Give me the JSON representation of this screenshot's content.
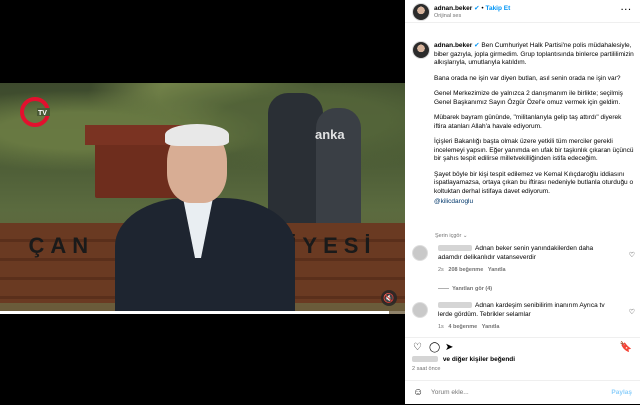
{
  "header": {
    "username": "adnan.beker",
    "verified_icon": "verified-badge-icon",
    "separator": "•",
    "follow_label": "Takip Et",
    "audio": "Orijinal ses",
    "more_icon": "more-dots-icon"
  },
  "video": {
    "channel_logo": "Tele1 TV",
    "watermark": "anka",
    "bench_text_left": "ÇAN",
    "bench_text_right": "DİYESİ",
    "progress_fraction": 0.96,
    "mute_icon": "muted-speaker-icon"
  },
  "caption": {
    "username": "adnan.beker",
    "paragraphs": [
      "Ben Cumhuriyet Halk Partisi'ne polis müdahalesiyle, biber gazıyla, jopla girmedim. Grup toplantısında binlerce partililimizin alkışlarıyla, umutlarıyla katıldım.",
      "Bana orada ne işin var diyen butlan, asıl senin orada ne işin var?",
      "Genel Merkezimize de yalnızca 2 danışmanım ile birlikte; seçilmiş Genel Başkanımız Sayın Özgür Özel'e omuz vermek için geldim.",
      "Mübarek bayram gününde, \"militanlarıyla gelip taş attırdı\" diyerek iftira atanları Allah'a havale ediyorum.",
      "İçişleri Bakanlığı başta olmak üzere yetkili tüm merciler gerekli incelemeyi yapsın. Eğer yanımda en ufak bir taşkınlık çıkaran üçüncü bir şahıs tespit edilirse milletvekilliğinden istifa edeceğim.",
      "Şayet böyle bir kişi tespit edilemez ve Kemal Kılıçdaroğlu iddiasını ispatlayamazsa, ortaya çıkan bu iftirası nedeniyle butlanla oturduğu o koltuktan derhal istifaya davet ediyorum."
    ],
    "mention": "@kilicdaroglu",
    "translate": "Çeviriyi gör"
  },
  "language_row": "Şerin içgör",
  "comments": [
    {
      "text": "Adnan beker senin yanındakilerden daha adamdır delikanlıdır vatanseverdir",
      "age": "2s",
      "likes": "208 beğenme",
      "reply": "Yanıtla",
      "view_replies": "Yanıtları gör (4)"
    },
    {
      "text": "Adnan kardeşim senibilirim inanırım Ayrıca tv lerde gördüm. Tebrikler selamlar",
      "age": "1s",
      "likes": "4 beğenme",
      "reply": "Yanıtla"
    }
  ],
  "actions": {
    "like_icon": "heart-icon",
    "comment_icon": "comment-icon",
    "share_icon": "paper-plane-icon",
    "save_icon": "bookmark-icon"
  },
  "liked_by": "ve diğer kişiler beğendi",
  "time_ago": "2 saat önce",
  "add_comment": {
    "placeholder": "Yorum ekle...",
    "post_label": "Paylaş",
    "emoji_icon": "smiley-icon"
  }
}
